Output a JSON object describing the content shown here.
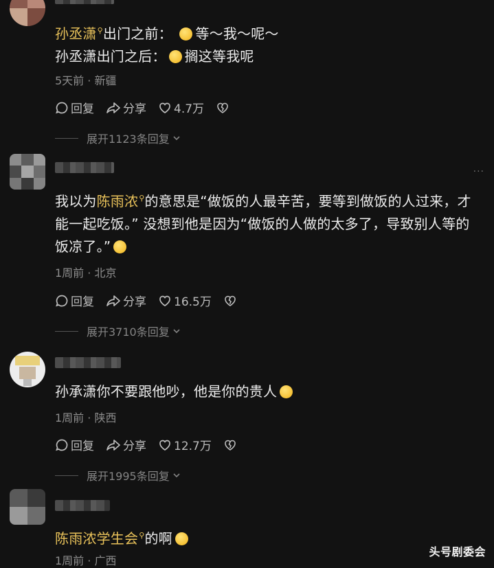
{
  "comments": [
    {
      "username": "孙丞潇",
      "line1_after": "出门之前：",
      "line1_tail": "等～我～呢～",
      "line2_text": "孙丞潇出门之后：",
      "line2_tail": "搁这等我呢",
      "meta": "5天前 · 新疆",
      "reply": "回复",
      "share": "分享",
      "likes": "4.7万",
      "expand": "展开1123条回复"
    },
    {
      "text_before": "我以为",
      "mention": "陈雨浓",
      "text_after": "的意思是“做饭的人最辛苦，要等到做饭的人过来，才能一起吃饭。” 没想到他是因为“做饭的人做的太多了，导致别人等的饭凉了。”",
      "meta": "1周前 · 北京",
      "reply": "回复",
      "share": "分享",
      "likes": "16.5万",
      "expand": "展开3710条回复"
    },
    {
      "text": "孙承潇你不要跟他吵，他是你的贵人",
      "meta": "1周前 · 陕西",
      "reply": "回复",
      "share": "分享",
      "likes": "12.7万",
      "expand": "展开1995条回复"
    },
    {
      "mention": "陈雨浓学生会",
      "text_after": "的啊",
      "meta": "1周前 · 广西"
    }
  ],
  "watermark": "头号剧委会",
  "colors": {
    "background": "#121212",
    "mention": "#e9c25a",
    "meta": "#8d8d8d"
  }
}
